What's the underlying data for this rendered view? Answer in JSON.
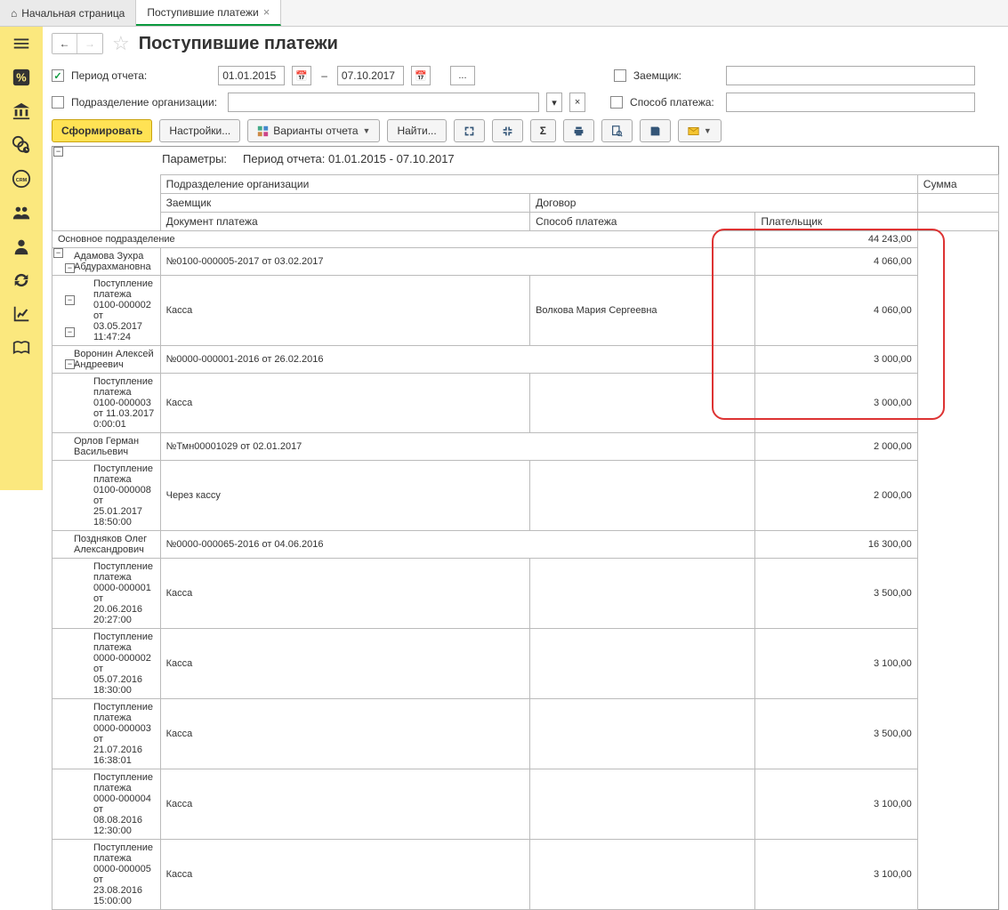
{
  "tabs": {
    "home": "Начальная страница",
    "active": "Поступившие платежи"
  },
  "title": "Поступившие платежи",
  "filters": {
    "period_label": "Период отчета:",
    "date_from": "01.01.2015",
    "date_to": "07.10.2017",
    "borrower_label": "Заемщик:",
    "orgdiv_label": "Подразделение организации:",
    "paymethod_label": "Способ платежа:"
  },
  "toolbar": {
    "generate": "Сформировать",
    "settings": "Настройки...",
    "variants": "Варианты отчета",
    "find": "Найти..."
  },
  "params": {
    "label": "Параметры:",
    "text": "Период отчета: 01.01.2015 - 07.10.2017"
  },
  "headers": {
    "orgdiv": "Подразделение организации",
    "sum": "Сумма",
    "borrower": "Заемщик",
    "contract": "Договор",
    "paydoc": "Документ платежа",
    "paymethod": "Способ платежа",
    "payer": "Плательщик"
  },
  "rows": [
    {
      "lvl": 0,
      "c0": "Основное подразделение",
      "c1": "",
      "c2": "",
      "sum": "44 243,00"
    },
    {
      "lvl": 1,
      "c0": "Адамова Зухра Абдурахмановна",
      "c1": "№0100-000005-2017 от 03.02.2017",
      "c2": "",
      "sum": "4 060,00"
    },
    {
      "lvl": 2,
      "c0": "Поступление платежа 0100-000002 от 03.05.2017 11:47:24",
      "c1": "Касса",
      "c2": "Волкова Мария Сергеевна",
      "sum": "4 060,00"
    },
    {
      "lvl": 1,
      "c0": "Воронин Алексей Андреевич",
      "c1": "№0000-000001-2016 от 26.02.2016",
      "c2": "",
      "sum": "3 000,00"
    },
    {
      "lvl": 2,
      "c0": "Поступление платежа 0100-000003 от 11.03.2017 0:00:01",
      "c1": "Касса",
      "c2": "",
      "sum": "3 000,00"
    },
    {
      "lvl": 1,
      "c0": "Орлов Герман Васильевич",
      "c1": "№Тмн00001029 от 02.01.2017",
      "c2": "",
      "sum": "2 000,00"
    },
    {
      "lvl": 2,
      "c0": "Поступление платежа 0100-000008 от 25.01.2017 18:50:00",
      "c1": "Через кассу",
      "c2": "",
      "sum": "2 000,00"
    },
    {
      "lvl": 1,
      "c0": "Поздняков Олег Александрович",
      "c1": "№0000-000065-2016 от 04.06.2016",
      "c2": "",
      "sum": "16 300,00"
    },
    {
      "lvl": 2,
      "c0": "Поступление платежа 0000-000001 от 20.06.2016 20:27:00",
      "c1": "Касса",
      "c2": "",
      "sum": "3 500,00"
    },
    {
      "lvl": 2,
      "c0": "Поступление платежа 0000-000002 от 05.07.2016 18:30:00",
      "c1": "Касса",
      "c2": "",
      "sum": "3 100,00"
    },
    {
      "lvl": 2,
      "c0": "Поступление платежа 0000-000003 от 21.07.2016 16:38:01",
      "c1": "Касса",
      "c2": "",
      "sum": "3 500,00"
    },
    {
      "lvl": 2,
      "c0": "Поступление платежа 0000-000004 от 08.08.2016 12:30:00",
      "c1": "Касса",
      "c2": "",
      "sum": "3 100,00"
    },
    {
      "lvl": 2,
      "c0": "Поступление платежа 0000-000005 от 23.08.2016 15:00:00",
      "c1": "Касса",
      "c2": "",
      "sum": "3 100,00"
    }
  ]
}
